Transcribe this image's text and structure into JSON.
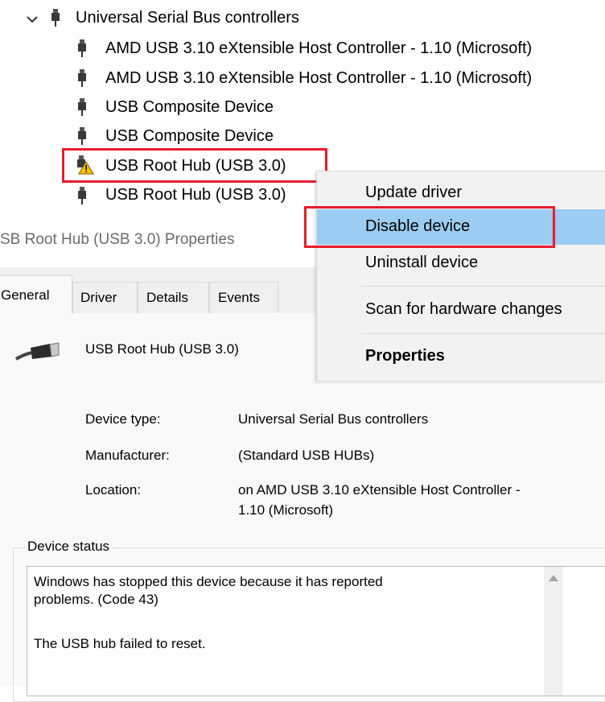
{
  "tree": {
    "category_label": "Universal Serial Bus controllers",
    "items": [
      {
        "label": "AMD USB 3.10 eXtensible Host Controller - 1.10 (Microsoft)",
        "warning": false
      },
      {
        "label": "AMD USB 3.10 eXtensible Host Controller - 1.10 (Microsoft)",
        "warning": false
      },
      {
        "label": "USB Composite Device",
        "warning": false
      },
      {
        "label": "USB Composite Device",
        "warning": false
      },
      {
        "label": "USB Root Hub (USB 3.0)",
        "warning": true
      },
      {
        "label": "USB Root Hub (USB 3.0)",
        "warning": false
      }
    ]
  },
  "context_menu": {
    "items": [
      {
        "label": "Update driver"
      },
      {
        "label": "Disable device",
        "highlighted": true
      },
      {
        "label": "Uninstall device"
      },
      {
        "label": "Scan for hardware changes"
      },
      {
        "label": "Properties",
        "bold": true
      }
    ]
  },
  "dialog": {
    "title": "SB Root Hub (USB 3.0) Properties",
    "tabs": [
      {
        "label": "General",
        "active": true
      },
      {
        "label": "Driver"
      },
      {
        "label": "Details"
      },
      {
        "label": "Events"
      }
    ],
    "device_name": "USB Root Hub (USB 3.0)",
    "fields": {
      "device_type_label": "Device type:",
      "device_type_value": "Universal Serial Bus controllers",
      "manufacturer_label": "Manufacturer:",
      "manufacturer_value": "(Standard USB HUBs)",
      "location_label": "Location:",
      "location_value_line1": "on AMD USB 3.10 eXtensible Host Controller -",
      "location_value_line2": "1.10 (Microsoft)"
    },
    "status": {
      "legend": "Device status",
      "line1": "Windows has stopped this device because it has reported",
      "line2": "problems. (Code 43)",
      "line3": "The USB hub failed to reset."
    }
  },
  "colors": {
    "highlight_border": "#e81c2c",
    "menu_selection": "#9cccf2",
    "warning_yellow": "#f5c400"
  },
  "icons": {
    "expand": "chevron-down-icon",
    "usb_device": "usb-plug-icon",
    "warning": "warning-triangle-icon",
    "usb_cable": "usb-cable-icon",
    "scroll_up": "scroll-up-arrow-icon"
  }
}
